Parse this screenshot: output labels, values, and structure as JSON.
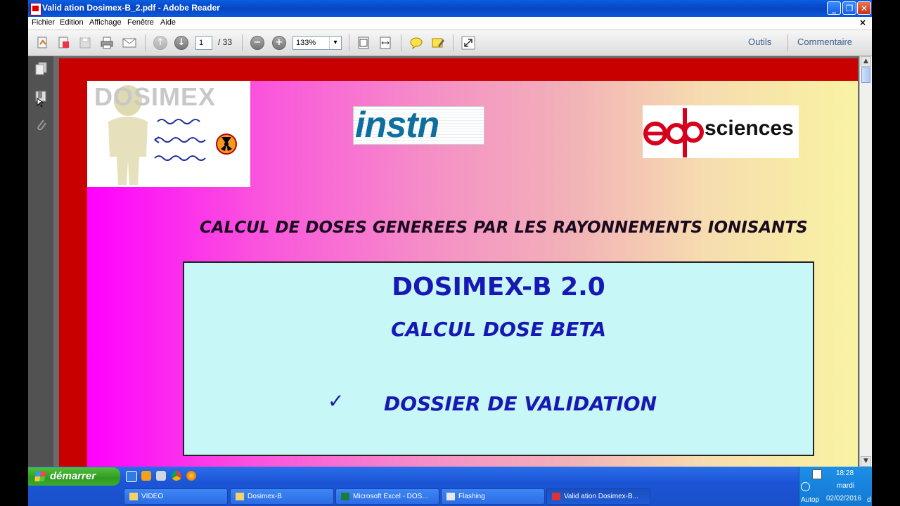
{
  "window": {
    "title": "Valid ation Dosimex-B_2.pdf - Adobe Reader",
    "minimize": "_",
    "maximize": "❐",
    "close": "✕"
  },
  "menu": {
    "items": [
      "Fichier",
      "Edition",
      "Affichage",
      "Fenêtre",
      "Aide"
    ],
    "close": "×"
  },
  "toolbar": {
    "page_current": "1",
    "page_total": "/ 33",
    "zoom": "133%",
    "zoom_arrow": "▾",
    "tools_label": "Outils",
    "comment_label": "Commentaire"
  },
  "document": {
    "logo_left": "DOSIMEX",
    "logo_center": "instn",
    "logo_right_text": "sciences",
    "headline": "CALCUL DE DOSES GENEREES PAR LES RAYONNEMENTS IONISANTS",
    "box_title": "DOSIMEX-B 2.0",
    "box_subtitle": "CALCUL DOSE BETA",
    "box_check": "✓",
    "box_item": "DOSSIER DE VALIDATION"
  },
  "taskbar": {
    "start_label": "démarrer",
    "tasks": [
      "VIDEO",
      "Dosimex-B",
      "Microsoft Excel - DOS...",
      "Flashing",
      "Valid ation Dosimex-B..."
    ],
    "clock_time": "18:28",
    "clock_day": "mardi",
    "clock_date": "02/02/2016",
    "tray_partial": "Autop",
    "tray_partial_d": "d"
  },
  "colors": {
    "slide_frame": "#c80000",
    "box_bg": "#c8f7f7",
    "box_text": "#1818b4",
    "edp_red": "#d6001c"
  }
}
